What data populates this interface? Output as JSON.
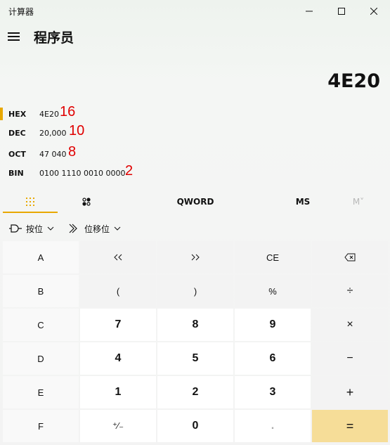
{
  "window": {
    "title": "计算器",
    "minimize_icon": "minimize-icon",
    "maximize_icon": "maximize-icon",
    "close_icon": "close-icon"
  },
  "header": {
    "menu_icon": "hamburger-menu-icon",
    "mode_title": "程序员"
  },
  "display": {
    "value": "4E20"
  },
  "bases": [
    {
      "name": "HEX",
      "value": "4E20",
      "annotation": "16",
      "selected": true
    },
    {
      "name": "DEC",
      "value": "20,000",
      "annotation": "10",
      "selected": false
    },
    {
      "name": "OCT",
      "value": "47 040",
      "annotation": "8",
      "selected": false
    },
    {
      "name": "BIN",
      "value": "0100 1110 0010 0000",
      "annotation": "2",
      "selected": false
    }
  ],
  "tabs": {
    "keypad_icon": "keypad-grid-icon",
    "bits_icon": "bit-toggle-icon",
    "word_size": "QWORD",
    "ms": "MS",
    "mplus": "M˅"
  },
  "operators": {
    "bitwise_label": "按位",
    "bitwise_icon": "logic-gate-icon",
    "shift_label": "位移位",
    "shift_icon": "bit-shift-icon"
  },
  "keys": [
    [
      "A",
      "«",
      "»",
      "CE",
      "⌫"
    ],
    [
      "B",
      "(",
      ")",
      "%",
      "÷"
    ],
    [
      "C",
      "7",
      "8",
      "9",
      "×"
    ],
    [
      "D",
      "4",
      "5",
      "6",
      "−"
    ],
    [
      "E",
      "1",
      "2",
      "3",
      "+"
    ],
    [
      "F",
      "⁺∕₋",
      "0",
      ".",
      "="
    ]
  ],
  "colors": {
    "accent": "#e8a800",
    "equals": "#f6dd98",
    "annotation": "#e00000"
  }
}
